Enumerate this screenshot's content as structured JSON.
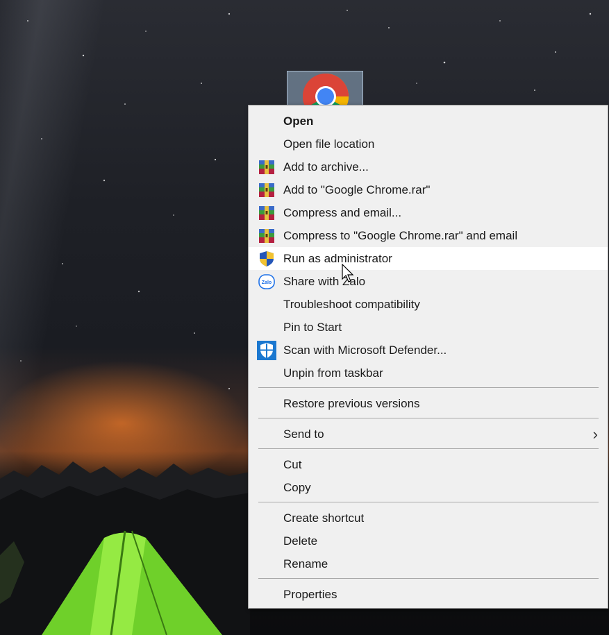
{
  "desktop": {
    "icon_name": "chrome-icon"
  },
  "menu": {
    "items": [
      {
        "label": "Open",
        "icon": ""
      },
      {
        "label": "Open file location",
        "icon": ""
      },
      {
        "label": "Add to archive...",
        "icon": "winrar-icon"
      },
      {
        "label": "Add to \"Google Chrome.rar\"",
        "icon": "winrar-icon"
      },
      {
        "label": "Compress and email...",
        "icon": "winrar-icon"
      },
      {
        "label": "Compress to \"Google Chrome.rar\" and email",
        "icon": "winrar-icon"
      },
      {
        "label": "Run as administrator",
        "icon": "uac-shield-icon"
      },
      {
        "label": "Share with Zalo",
        "icon": "zalo-icon"
      },
      {
        "label": "Troubleshoot compatibility",
        "icon": ""
      },
      {
        "label": "Pin to Start",
        "icon": ""
      },
      {
        "label": "Scan with Microsoft Defender...",
        "icon": "defender-icon"
      },
      {
        "label": "Unpin from taskbar",
        "icon": ""
      },
      {
        "label": "Restore previous versions",
        "icon": ""
      },
      {
        "label": "Send to",
        "icon": "chevron-right-icon"
      },
      {
        "label": "Cut",
        "icon": ""
      },
      {
        "label": "Copy",
        "icon": ""
      },
      {
        "label": "Create shortcut",
        "icon": ""
      },
      {
        "label": "Delete",
        "icon": ""
      },
      {
        "label": "Rename",
        "icon": ""
      },
      {
        "label": "Properties",
        "icon": ""
      }
    ],
    "zalo_icon_text": "Zalo",
    "send_to_arrow": "›"
  },
  "colors": {
    "menu_bg": "#f0f0f0",
    "hover_bg": "#ffffff",
    "separator": "#a8a8a8",
    "text": "#1a1a1a"
  }
}
